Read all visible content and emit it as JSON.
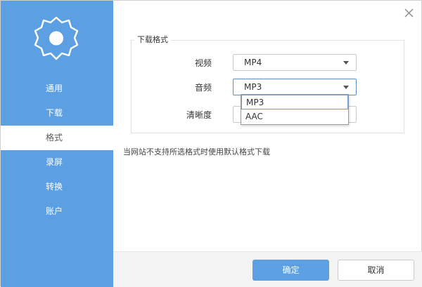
{
  "colors": {
    "accent": "#5ca0e3",
    "dropdown_highlight": "#6f9fd3"
  },
  "sidebar": {
    "logo_icon": "gear-icon",
    "items": [
      {
        "label": "通用",
        "active": false
      },
      {
        "label": "下载",
        "active": false
      },
      {
        "label": "格式",
        "active": true
      },
      {
        "label": "录屏",
        "active": false
      },
      {
        "label": "转换",
        "active": false
      },
      {
        "label": "账户",
        "active": false
      }
    ]
  },
  "window": {
    "close_icon": "close-icon"
  },
  "format_group": {
    "legend": "下载格式",
    "video": {
      "label": "视频",
      "value": "MP4"
    },
    "audio": {
      "label": "音频",
      "value": "MP3",
      "options": [
        "MP3",
        "AAC"
      ],
      "highlighted_option": "MP3"
    },
    "quality": {
      "label": "清晰度"
    }
  },
  "hint": "当网站不支持所选格式时使用默认格式下载",
  "footer": {
    "ok_label": "确定",
    "cancel_label": "取消"
  }
}
